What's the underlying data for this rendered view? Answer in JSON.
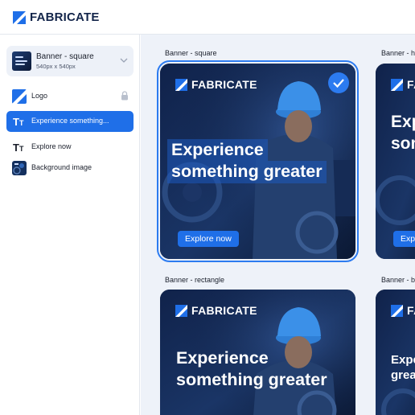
{
  "app": {
    "brand": "FABRICATE"
  },
  "colors": {
    "accent": "#1f6fe8",
    "brand_dark": "#13254a",
    "banner_bg": "#0d1a37"
  },
  "sidebar": {
    "template": {
      "name": "Banner - square",
      "size": "540px x 540px"
    },
    "layers": [
      {
        "label": "Logo",
        "icon": "logo-icon",
        "locked": true
      },
      {
        "label": "Experience something...",
        "icon": "text-icon",
        "active": true
      },
      {
        "label": "Explore now",
        "icon": "text-icon"
      },
      {
        "label": "Background image",
        "icon": "image-thumbnail-icon"
      }
    ]
  },
  "canvas": {
    "banners": [
      {
        "caption": "Banner - square",
        "brand": "FABRICATE",
        "headline_1": "Experience",
        "headline_2": "something greater",
        "cta": "Explore now",
        "selected": true
      },
      {
        "caption": "Banner - h",
        "brand": "FA",
        "headline_1": "Exp",
        "headline_2": "som",
        "cta": "Exp"
      },
      {
        "caption": "Banner - rectangle",
        "brand": "FABRICATE",
        "headline_1": "Experience",
        "headline_2": "something greater"
      },
      {
        "caption": "Banner - b",
        "brand": "FA",
        "headline_1": "Expe",
        "headline_2": "grea"
      }
    ]
  }
}
